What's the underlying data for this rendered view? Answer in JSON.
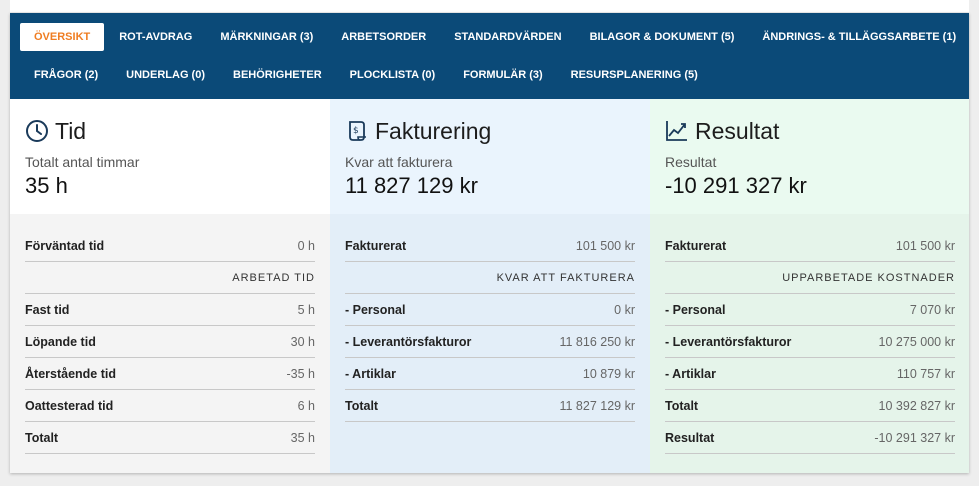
{
  "nav": {
    "row1": [
      {
        "label": "ÖVERSIKT",
        "active": true,
        "name": "tab-oversikt"
      },
      {
        "label": "ROT-AVDRAG",
        "name": "tab-rot-avdrag"
      },
      {
        "label": "MÄRKNINGAR (3)",
        "name": "tab-markningar"
      },
      {
        "label": "ARBETSORDER",
        "name": "tab-arbetsorder"
      },
      {
        "label": "STANDARDVÄRDEN",
        "name": "tab-standardvarden"
      },
      {
        "label": "BILAGOR & DOKUMENT (5)",
        "name": "tab-bilagor-dokument"
      },
      {
        "label": "ÄNDRINGS- & TILLÄGGSARBETE (1)",
        "name": "tab-andrings-tillaggsarbete"
      }
    ],
    "row2": [
      {
        "label": "FRÅGOR (2)",
        "name": "tab-fragor"
      },
      {
        "label": "UNDERLAG (0)",
        "name": "tab-underlag"
      },
      {
        "label": "BEHÖRIGHETER",
        "name": "tab-behorigheter"
      },
      {
        "label": "PLOCKLISTA (0)",
        "name": "tab-plocklista"
      },
      {
        "label": "FORMULÄR (3)",
        "name": "tab-formular"
      },
      {
        "label": "RESURSPLANERING (5)",
        "name": "tab-resursplanering"
      }
    ]
  },
  "colors": {
    "nav_bg": "#0b4a78",
    "active_tab_text": "#ef7d22"
  },
  "tid": {
    "icon": "clock-icon",
    "title": "Tid",
    "sub_label": "Totalt antal timmar",
    "big_value": "35 h",
    "rows": [
      {
        "label": "Förväntad tid",
        "value": "0 h"
      },
      {
        "section": "ARBETAD TID"
      },
      {
        "label": "Fast tid",
        "value": "5 h"
      },
      {
        "label": "Löpande tid",
        "value": "30 h"
      },
      {
        "label": "Återstående tid",
        "value": "-35 h"
      },
      {
        "label": "Oattesterad tid",
        "value": "6 h"
      },
      {
        "label": "Totalt",
        "value": "35 h"
      }
    ]
  },
  "fakturering": {
    "icon": "receipt-icon",
    "title": "Fakturering",
    "sub_label": "Kvar att fakturera",
    "big_value": "11 827 129 kr",
    "rows": [
      {
        "label": "Fakturerat",
        "value": "101 500 kr"
      },
      {
        "section": "KVAR ATT FAKTURERA"
      },
      {
        "label": "- Personal",
        "value": "0 kr"
      },
      {
        "label": "- Leverantörsfakturor",
        "value": "11 816 250 kr"
      },
      {
        "label": "- Artiklar",
        "value": "10 879 kr"
      },
      {
        "label": "Totalt",
        "value": "11 827 129 kr"
      }
    ]
  },
  "resultat": {
    "icon": "trend-chart-icon",
    "title": "Resultat",
    "sub_label": "Resultat",
    "big_value": "-10 291 327 kr",
    "rows": [
      {
        "label": "Fakturerat",
        "value": "101 500 kr"
      },
      {
        "section": "UPPARBETADE KOSTNADER"
      },
      {
        "label": "- Personal",
        "value": "7 070 kr"
      },
      {
        "label": "- Leverantörsfakturor",
        "value": "10 275 000 kr"
      },
      {
        "label": "- Artiklar",
        "value": "110 757 kr"
      },
      {
        "label": "Totalt",
        "value": "10 392 827 kr"
      },
      {
        "label": "Resultat",
        "value": "-10 291 327 kr"
      }
    ]
  }
}
